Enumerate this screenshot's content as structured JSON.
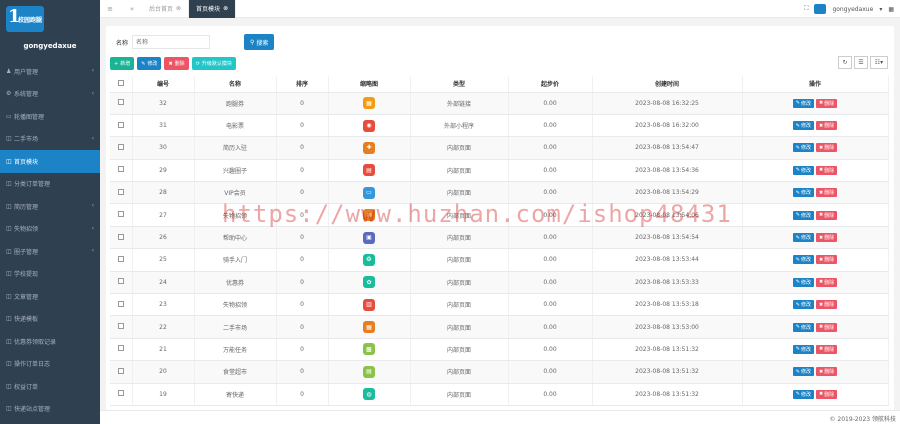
{
  "brand": {
    "logo_num": "1",
    "logo_text": "校园跑腿",
    "user": "gongyedaxue"
  },
  "sidebar": {
    "items": [
      {
        "icon": "♟",
        "label": "用户管理",
        "arrow": "‹",
        "active": false
      },
      {
        "icon": "⚙",
        "label": "系统管理",
        "arrow": "‹",
        "active": false
      },
      {
        "icon": "▭",
        "label": "轮播图管理",
        "arrow": "",
        "active": false
      },
      {
        "icon": "◫",
        "label": "二手市场",
        "arrow": "‹",
        "active": false
      },
      {
        "icon": "◫",
        "label": "首页模块",
        "arrow": "",
        "active": true
      },
      {
        "icon": "◫",
        "label": "分类订单管理",
        "arrow": "",
        "active": false
      },
      {
        "icon": "◫",
        "label": "简历管理",
        "arrow": "‹",
        "active": false
      },
      {
        "icon": "◫",
        "label": "失物招领",
        "arrow": "‹",
        "active": false
      },
      {
        "icon": "◫",
        "label": "圈子管理",
        "arrow": "‹",
        "active": false
      },
      {
        "icon": "◫",
        "label": "学校提现",
        "arrow": "",
        "active": false
      },
      {
        "icon": "◫",
        "label": "文章管理",
        "arrow": "",
        "active": false
      },
      {
        "icon": "◫",
        "label": "快递模板",
        "arrow": "",
        "active": false
      },
      {
        "icon": "◫",
        "label": "优惠券领取记录",
        "arrow": "",
        "active": false
      },
      {
        "icon": "◫",
        "label": "操作订单日志",
        "arrow": "",
        "active": false
      },
      {
        "icon": "◫",
        "label": "权益订单",
        "arrow": "",
        "active": false
      },
      {
        "icon": "◫",
        "label": "快递站点管理",
        "arrow": "",
        "active": false
      }
    ]
  },
  "topbar": {
    "menu_icon": "≡",
    "back_icon": "«",
    "tabs": [
      {
        "label": "后台首页",
        "active": false
      },
      {
        "label": "首页模块",
        "active": true
      }
    ],
    "user": "gongyedaxue"
  },
  "search": {
    "label": "名称",
    "placeholder": "名称",
    "button": "搜索"
  },
  "toolbar": {
    "add": "新增",
    "edit": "修改",
    "delete": "删除",
    "upgrade": "升级默认模块"
  },
  "table": {
    "headers": [
      "编号",
      "名称",
      "排序",
      "缩略图",
      "类型",
      "起步价",
      "创建时间",
      "操作"
    ],
    "edit_label": "修改",
    "delete_label": "删除",
    "rows": [
      {
        "id": "32",
        "name": "跑腿券",
        "sort": "0",
        "icon_color": "#f39c12",
        "type": "外部链接",
        "price": "0.00",
        "time": "2023-08-08 16:32:25"
      },
      {
        "id": "31",
        "name": "电影票",
        "sort": "0",
        "icon_color": "#e74c3c",
        "type": "外部小程序",
        "price": "0.00",
        "time": "2023-08-08 16:32:00"
      },
      {
        "id": "30",
        "name": "简历入驻",
        "sort": "0",
        "icon_color": "#e67e22",
        "type": "内部页面",
        "price": "0.00",
        "time": "2023-08-08 13:54:47"
      },
      {
        "id": "29",
        "name": "兴趣圈子",
        "sort": "0",
        "icon_color": "#e74c3c",
        "type": "内部页面",
        "price": "0.00",
        "time": "2023-08-08 13:54:36"
      },
      {
        "id": "28",
        "name": "VIP会员",
        "sort": "0",
        "icon_color": "#3498db",
        "type": "内部页面",
        "price": "0.00",
        "time": "2023-08-08 13:54:29"
      },
      {
        "id": "27",
        "name": "失物招领",
        "sort": "0",
        "icon_color": "#e67e22",
        "type": "内部页面",
        "price": "0.00",
        "time": "2023-08-08 13:54:06"
      },
      {
        "id": "26",
        "name": "帮助中心",
        "sort": "0",
        "icon_color": "#5b6abf",
        "type": "内部页面",
        "price": "0.00",
        "time": "2023-08-08 13:54:54"
      },
      {
        "id": "25",
        "name": "骑手入门",
        "sort": "0",
        "icon_color": "#1abc9c",
        "type": "内部页面",
        "price": "0.00",
        "time": "2023-08-08 13:53:44"
      },
      {
        "id": "24",
        "name": "优惠券",
        "sort": "0",
        "icon_color": "#1abc9c",
        "type": "内部页面",
        "price": "0.00",
        "time": "2023-08-08 13:53:33"
      },
      {
        "id": "23",
        "name": "失物招领",
        "sort": "0",
        "icon_color": "#e74c3c",
        "type": "内部页面",
        "price": "0.00",
        "time": "2023-08-08 13:53:18"
      },
      {
        "id": "22",
        "name": "二手市场",
        "sort": "0",
        "icon_color": "#e67e22",
        "type": "内部页面",
        "price": "0.00",
        "time": "2023-08-08 13:53:00"
      },
      {
        "id": "21",
        "name": "万能任务",
        "sort": "0",
        "icon_color": "#8bc34a",
        "type": "内部页面",
        "price": "0.00",
        "time": "2023-08-08 13:51:32"
      },
      {
        "id": "20",
        "name": "食堂超市",
        "sort": "0",
        "icon_color": "#8bc34a",
        "type": "内部页面",
        "price": "0.00",
        "time": "2023-08-08 13:51:32"
      },
      {
        "id": "19",
        "name": "寄快递",
        "sort": "0",
        "icon_color": "#1abc9c",
        "type": "内部页面",
        "price": "0.00",
        "time": "2023-08-08 13:51:32"
      }
    ]
  },
  "watermark": "https://www.huzhan.com/ishop48431",
  "footer": "© 2019-2023 领航科技",
  "colors": {
    "sidebar": "#2f4050",
    "accent": "#1c84c6",
    "green": "#1ab394",
    "red": "#ed5565",
    "teal": "#23c6c8"
  }
}
